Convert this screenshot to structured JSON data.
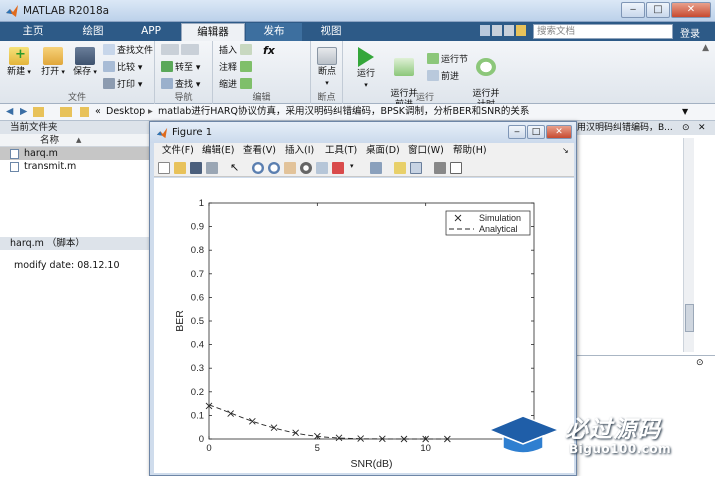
{
  "app": {
    "title": "MATLAB R2018a"
  },
  "tabs": [
    {
      "label": "主页"
    },
    {
      "label": "绘图"
    },
    {
      "label": "APP"
    },
    {
      "label": "编辑器"
    },
    {
      "label": "发布"
    },
    {
      "label": "视图"
    }
  ],
  "search": {
    "placeholder": "搜索文档"
  },
  "login_label": "登录",
  "ribbon": {
    "file": {
      "label": "文件",
      "new": "新建",
      "open": "打开",
      "save": "保存",
      "find_files": "查找文件",
      "compare": "比较",
      "print": "打印"
    },
    "navigate": {
      "label": "导航",
      "goto": "转至",
      "find": "查找"
    },
    "edit": {
      "label": "编辑",
      "insert": "插入",
      "comment": "注释",
      "indent": "缩进",
      "fx": "fx"
    },
    "breakpoints": {
      "label": "断点",
      "breakpoints": "断点"
    },
    "run": {
      "label": "运行",
      "run": "运行",
      "run_advance": "运行并\n前进",
      "run_section": "运行节",
      "advance": "前进",
      "run_time": "运行并\n计时"
    }
  },
  "address": {
    "prefix": "«",
    "desktop": "Desktop",
    "sep": "▸",
    "folder": "matlab进行HARQ协议仿真，采用汉明码纠错编码，BPSK调制，分析BER和SNR的关系"
  },
  "current_folder": {
    "title": "当前文件夹",
    "column_name": "名称",
    "sort_indicator": "▲",
    "files": [
      {
        "name": "harq.m",
        "selected": true
      },
      {
        "name": "transmit.m",
        "selected": false
      }
    ]
  },
  "details": {
    "title": "harq.m （脚本）",
    "text": "modify date: 08.12.10"
  },
  "right_strip_text": "用汉明码纠错编码，B...",
  "figure": {
    "title": "Figure 1",
    "menus": [
      "文件(F)",
      "编辑(E)",
      "查看(V)",
      "插入(I)",
      "工具(T)",
      "桌面(D)",
      "窗口(W)",
      "帮助(H)"
    ]
  },
  "watermark": {
    "text": "必过源码",
    "url": "Biguo100.com"
  },
  "colors": {
    "tabbar": "#2d5a87",
    "editor_tab": "#eef1f5",
    "accent": "#3d6f9f"
  },
  "chart_data": {
    "type": "line",
    "xlabel": "SNR(dB)",
    "ylabel": "BER",
    "xlim": [
      0,
      15
    ],
    "ylim": [
      0,
      1
    ],
    "xticks": [
      "0",
      "5",
      "10"
    ],
    "yticks": [
      "0",
      "0.1",
      "0.2",
      "0.3",
      "0.4",
      "0.5",
      "0.6",
      "0.7",
      "0.8",
      "0.9",
      "1"
    ],
    "grid": false,
    "legend_position": "top-right",
    "series": [
      {
        "name": "Simulation",
        "marker": "x",
        "line": "none",
        "x": [
          0,
          1,
          2,
          3,
          4,
          5,
          6,
          7,
          8,
          9,
          10,
          11
        ],
        "y": [
          0.14,
          0.108,
          0.075,
          0.048,
          0.026,
          0.012,
          0.005,
          0.002,
          0.001,
          0.0,
          0.0,
          0.0
        ]
      },
      {
        "name": "Analytical",
        "marker": "none",
        "line": "dashed",
        "x": [
          0,
          0.5,
          1,
          1.5,
          2,
          2.5,
          3,
          3.5,
          4,
          4.5,
          5,
          5.5,
          6,
          7,
          8,
          9,
          10,
          11
        ],
        "y": [
          0.145,
          0.128,
          0.11,
          0.092,
          0.075,
          0.06,
          0.047,
          0.035,
          0.025,
          0.017,
          0.011,
          0.007,
          0.004,
          0.001,
          0.0005,
          0.0,
          0.0,
          0.0
        ]
      }
    ]
  }
}
